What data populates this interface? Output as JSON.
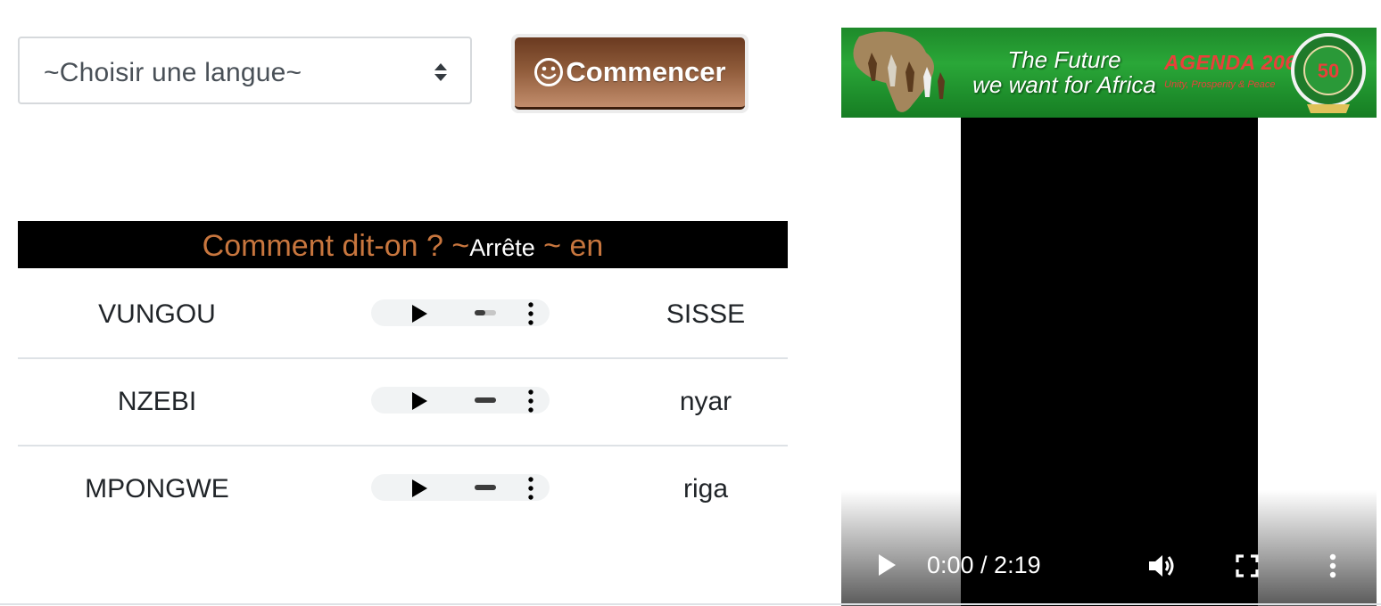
{
  "language_select": {
    "placeholder": "~Choisir une langue~"
  },
  "start_button": {
    "label": "Commencer",
    "icon": "smiley-icon"
  },
  "table": {
    "header": {
      "prefix": "Comment dit-on ? ~",
      "word": "Arrête",
      "suffix": " ~ en"
    },
    "rows": [
      {
        "language": "VUNGOU",
        "translation": "SISSE",
        "audio_volume": 0.5
      },
      {
        "language": "NZEBI",
        "translation": "nyar",
        "audio_volume": 1.0
      },
      {
        "language": "MPONGWE",
        "translation": "riga",
        "audio_volume": 1.0
      }
    ]
  },
  "banner": {
    "tagline_line1": "The Future",
    "tagline_line2": "we want for Africa",
    "agenda": "AGENDA 2063",
    "subline": "Unity, Prosperity & Peace",
    "seal_number": "50"
  },
  "video": {
    "time": "0:00 / 2:19"
  },
  "colors": {
    "header_text": "#c8763e",
    "button_brown": "#8e5a39",
    "banner_green": "#2aa738"
  }
}
